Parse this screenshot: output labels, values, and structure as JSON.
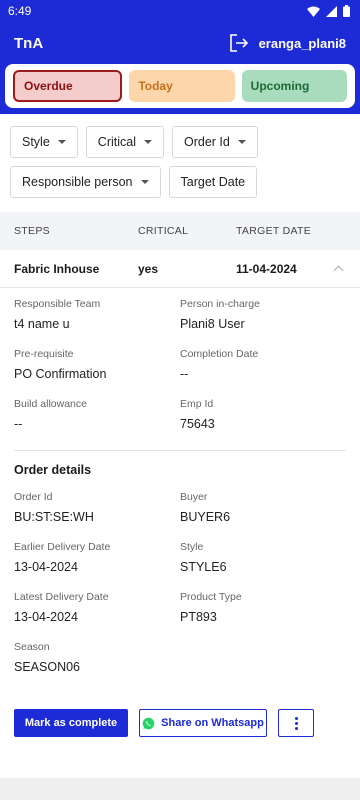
{
  "status_bar": {
    "time": "6:49"
  },
  "app": {
    "title": "TnA",
    "username": "eranga_plani8"
  },
  "status_chips": {
    "overdue": "Overdue",
    "today": "Today",
    "upcoming": "Upcoming"
  },
  "filters": {
    "style": "Style",
    "critical": "Critical",
    "order_id": "Order Id",
    "responsible_person": "Responsible person",
    "target_date": "Target Date"
  },
  "table": {
    "headers": {
      "steps": "STEPS",
      "critical": "CRITICAL",
      "target_date": "TARGET DATE"
    },
    "row": {
      "step": "Fabric Inhouse",
      "critical": "yes",
      "target_date": "11-04-2024"
    }
  },
  "details": {
    "responsible_team": {
      "label": "Responsible Team",
      "value": "t4 name u"
    },
    "person_in_charge": {
      "label": "Person in-charge",
      "value": "Plani8 User"
    },
    "pre_requisite": {
      "label": "Pre-requisite",
      "value": "PO Confirmation"
    },
    "completion_date": {
      "label": "Completion Date",
      "value": "--"
    },
    "build_allowance": {
      "label": "Build allowance",
      "value": "--"
    },
    "emp_id": {
      "label": "Emp Id",
      "value": "75643"
    }
  },
  "order_details": {
    "title": "Order details",
    "order_id": {
      "label": "Order Id",
      "value": "BU:ST:SE:WH"
    },
    "buyer": {
      "label": "Buyer",
      "value": "BUYER6"
    },
    "earlier_delivery_date": {
      "label": "Earlier Delivery Date",
      "value": "13-04-2024"
    },
    "style": {
      "label": "Style",
      "value": "STYLE6"
    },
    "latest_delivery_date": {
      "label": "Latest Delivery Date",
      "value": "13-04-2024"
    },
    "product_type": {
      "label": "Product Type",
      "value": "PT893"
    },
    "season": {
      "label": "Season",
      "value": "SEASON06"
    }
  },
  "actions": {
    "mark_complete": "Mark as complete",
    "share_whatsapp": "Share on Whatsapp"
  },
  "colors": {
    "primary": "#1d2bd6",
    "overdue_bg": "#f4cccc",
    "today_bg": "#fdd6ac",
    "upcoming_bg": "#a8dcbd",
    "whatsapp": "#25d366"
  }
}
